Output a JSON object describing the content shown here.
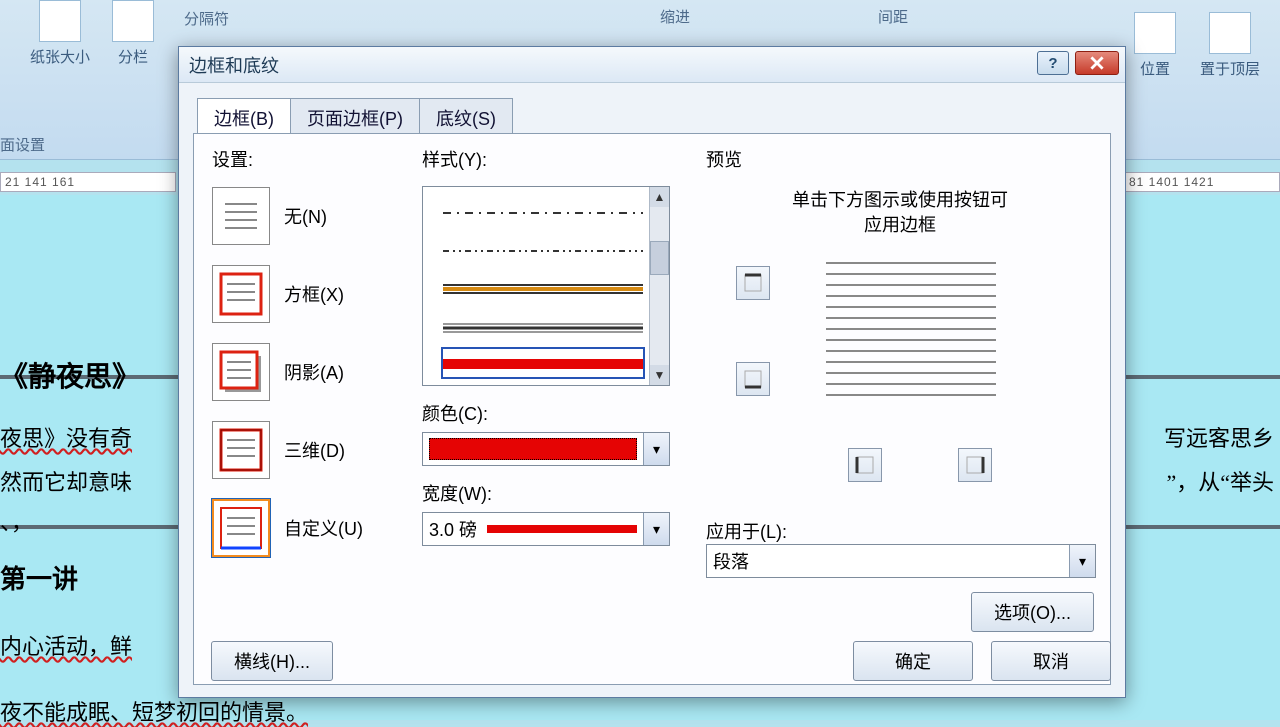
{
  "ribbon": {
    "indent_group": "缩进",
    "spacing_group": "间距",
    "position": "位置",
    "bring_front": "置于顶层",
    "page_size": "纸张大小",
    "columns": "分栏",
    "breaks": "分隔符",
    "page_setup_group": "面设置"
  },
  "ruler_left": "21   141   161",
  "ruler_right": "81   1401   1421",
  "doc": {
    "title": "《静夜思》",
    "p1": "夜思》没有奇",
    "p2": "然而它却意味",
    "p3": "、，",
    "heading": "第一讲",
    "p4": "内心活动，鲜",
    "p5": "夜不能成眠、短梦初回的情景。",
    "right1": "写远客思乡",
    "right2": "”，从“举头"
  },
  "dialog": {
    "title": "边框和底纹",
    "tabs": {
      "borders": "边框(B)",
      "page_borders": "页面边框(P)",
      "shading": "底纹(S)"
    },
    "settings_label": "设置:",
    "settings": {
      "none": "无(N)",
      "box": "方框(X)",
      "shadow": "阴影(A)",
      "threeD": "三维(D)",
      "custom": "自定义(U)"
    },
    "style_label": "样式(Y):",
    "color_label": "颜色(C):",
    "width_label": "宽度(W):",
    "width_value": "3.0 磅",
    "preview_label": "预览",
    "preview_hint_l1": "单击下方图示或使用按钮可",
    "preview_hint_l2": "应用边框",
    "apply_to_label": "应用于(L):",
    "apply_to_value": "段落",
    "options_btn": "选项(O)...",
    "hline_btn": "横线(H)...",
    "ok": "确定",
    "cancel": "取消"
  }
}
